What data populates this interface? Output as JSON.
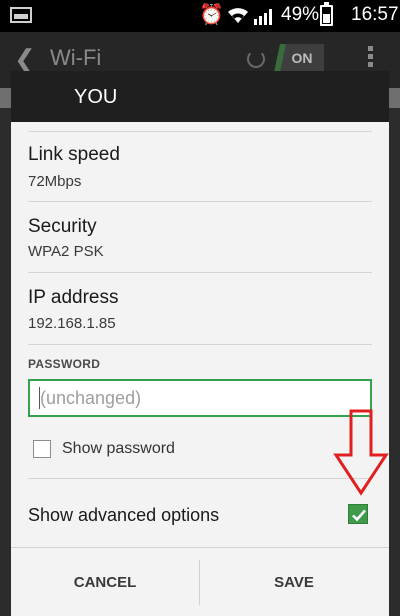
{
  "status_bar": {
    "battery_percent": "49%",
    "time": "16:57",
    "icons": [
      "image-notification-icon",
      "alarm-icon",
      "wifi-icon",
      "signal-icon",
      "battery-icon"
    ]
  },
  "action_bar": {
    "title": "Wi-Fi",
    "toggle_label": "ON"
  },
  "dialog": {
    "title": "YOU",
    "fields": [
      {
        "label": "Link speed",
        "value": "72Mbps"
      },
      {
        "label": "Security",
        "value": "WPA2 PSK"
      },
      {
        "label": "IP address",
        "value": "192.168.1.85"
      }
    ],
    "password": {
      "label": "PASSWORD",
      "placeholder": "(unchanged)",
      "value": ""
    },
    "show_password": {
      "label": "Show password",
      "checked": false
    },
    "advanced": {
      "label": "Show advanced options",
      "checked": true
    },
    "buttons": {
      "cancel": "CANCEL",
      "save": "SAVE"
    }
  },
  "colors": {
    "accent_green": "#34a24d",
    "annotation_red": "#e02020",
    "dialog_header": "#1f1f1f"
  }
}
